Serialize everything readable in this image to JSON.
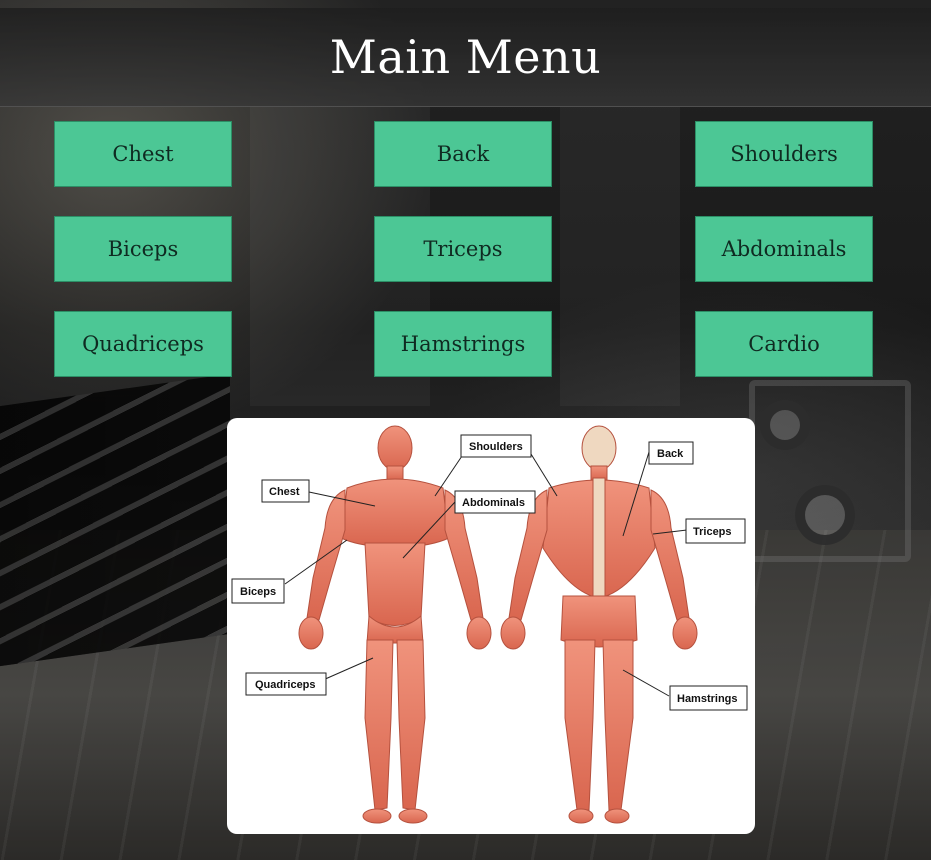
{
  "header": {
    "title": "Main Menu"
  },
  "menu": {
    "buttons": [
      {
        "label": "Chest"
      },
      {
        "label": "Back"
      },
      {
        "label": "Shoulders"
      },
      {
        "label": "Biceps"
      },
      {
        "label": "Triceps"
      },
      {
        "label": "Abdominals"
      },
      {
        "label": "Quadriceps"
      },
      {
        "label": "Hamstrings"
      },
      {
        "label": "Cardio"
      }
    ]
  },
  "diagram": {
    "labels": {
      "shoulders": "Shoulders",
      "chest": "Chest",
      "abdominals": "Abdominals",
      "biceps": "Biceps",
      "quadriceps": "Quadriceps",
      "back": "Back",
      "triceps": "Triceps",
      "hamstrings": "Hamstrings"
    }
  },
  "colors": {
    "button_bg": "#4cc795",
    "header_bg": "#2b2b2b",
    "muscle": "#e8806a"
  }
}
